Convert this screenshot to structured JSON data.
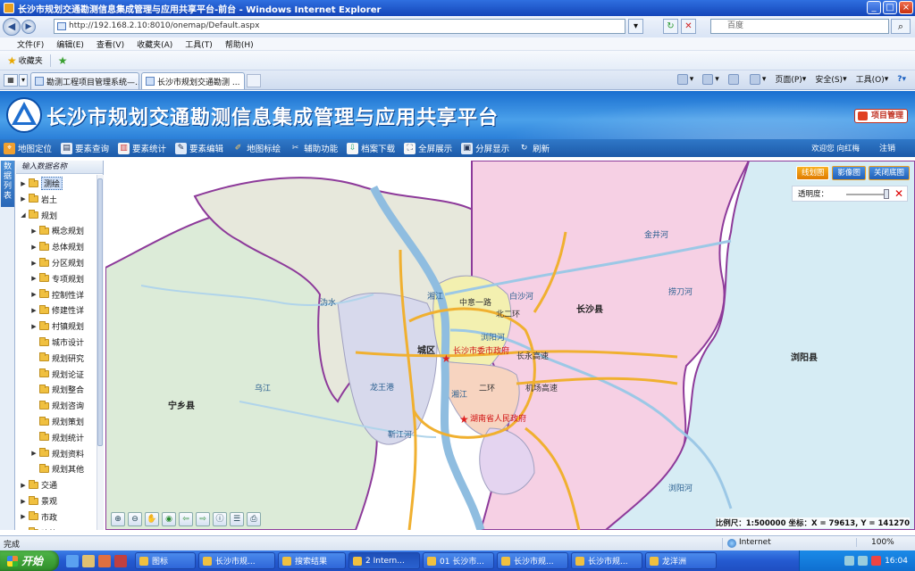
{
  "window": {
    "title": "长沙市规划交通勘测信息集成管理与应用共享平台-前台 - Windows Internet Explorer"
  },
  "browser": {
    "url": "http://192.168.2.10:8010/onemap/Default.aspx",
    "search_placeholder": "百度",
    "menu": [
      "文件(F)",
      "编辑(E)",
      "查看(V)",
      "收藏夹(A)",
      "工具(T)",
      "帮助(H)"
    ],
    "favorites_label": "收藏夹",
    "tabs": [
      {
        "label": "勘测工程项目管理系统—...",
        "active": false
      },
      {
        "label": "长沙市规划交通勘测 ...",
        "active": true
      }
    ],
    "commands": [
      "页面(P)",
      "安全(S)",
      "工具(O)"
    ],
    "status": "完成",
    "zone": "Internet",
    "zoom": "100%"
  },
  "app": {
    "title": "长沙市规划交通勘测信息集成管理与应用共享平台",
    "project_button": "项目管理",
    "toolbar": [
      {
        "label": "地图定位",
        "icon": "map-pin-icon"
      },
      {
        "label": "要素查询",
        "icon": "query-icon"
      },
      {
        "label": "要素统计",
        "icon": "chart-icon"
      },
      {
        "label": "要素编辑",
        "icon": "edit-icon"
      },
      {
        "label": "地图标绘",
        "icon": "draw-icon"
      },
      {
        "label": "辅助功能",
        "icon": "tools-icon"
      },
      {
        "label": "档案下载",
        "icon": "download-icon"
      },
      {
        "label": "全屏展示",
        "icon": "fullscreen-icon"
      },
      {
        "label": "分屏显示",
        "icon": "split-screen-icon"
      },
      {
        "label": "刷新",
        "icon": "refresh-icon"
      }
    ],
    "welcome": "欢迎您  向红梅",
    "logout": "注销",
    "side_tab": "数据列表",
    "side_header": "输入数据名称",
    "tree": [
      {
        "label": "测绘",
        "level": 0,
        "expanded": false,
        "selected": true
      },
      {
        "label": "岩土",
        "level": 0,
        "expanded": false
      },
      {
        "label": "规划",
        "level": 0,
        "expanded": true
      },
      {
        "label": "概念规划",
        "level": 1,
        "expanded": false
      },
      {
        "label": "总体规划",
        "level": 1,
        "expanded": false
      },
      {
        "label": "分区规划",
        "level": 1,
        "expanded": false
      },
      {
        "label": "专项规划",
        "level": 1,
        "expanded": false
      },
      {
        "label": "控制性详",
        "level": 1,
        "expanded": false
      },
      {
        "label": "修建性详",
        "level": 1,
        "expanded": false
      },
      {
        "label": "村镇规划",
        "level": 1,
        "expanded": false
      },
      {
        "label": "城市设计",
        "level": 1,
        "leaf": true
      },
      {
        "label": "规划研究",
        "level": 1,
        "leaf": true
      },
      {
        "label": "规划论证",
        "level": 1,
        "leaf": true
      },
      {
        "label": "规划整合",
        "level": 1,
        "leaf": true
      },
      {
        "label": "规划咨询",
        "level": 1,
        "leaf": true
      },
      {
        "label": "规划策划",
        "level": 1,
        "leaf": true
      },
      {
        "label": "规划统计",
        "level": 1,
        "leaf": true
      },
      {
        "label": "规划资料",
        "level": 1,
        "expanded": false
      },
      {
        "label": "规划其他",
        "level": 1,
        "leaf": true
      },
      {
        "label": "交通",
        "level": 0,
        "expanded": false
      },
      {
        "label": "景观",
        "level": 0,
        "expanded": false
      },
      {
        "label": "市政",
        "level": 0,
        "expanded": false
      },
      {
        "label": "建筑",
        "level": 0,
        "expanded": false
      }
    ],
    "map_buttons": [
      {
        "label": "线划图",
        "active": true
      },
      {
        "label": "影像图",
        "active": false
      },
      {
        "label": "关闭底图",
        "active": false
      }
    ],
    "transparency_label": "透明度：",
    "transparency_value": 0.95,
    "scale_text": "比例尺：1:500000  坐标：X = 79613, Y = 141270",
    "map_labels": {
      "county_ningxiang": "宁乡县",
      "county_changsha": "长沙县",
      "county_liuyang": "浏阳县",
      "city_district": "城区",
      "gov_city": "长沙市委市政府",
      "gov_province": "湖南省人民政府",
      "river_xiang": "湘江",
      "river_xiang2": "湘江",
      "river_wu": "乌江",
      "river_wei": "沩水",
      "river_liuyang": "浏阳河",
      "river_liuyang2": "浏阳河",
      "river_laodao": "捞刀河",
      "river_baisha": "白沙河",
      "river_jin": "金井河",
      "river_jinjiang": "靳江河",
      "river_longwang": "龙王港",
      "ring_north": "北二环",
      "ring_south": "二环",
      "road_airport": "机场高速",
      "road_changyong": "长永高速",
      "road_zhongyi": "中意一路"
    }
  },
  "taskbar": {
    "start": "开始",
    "tasks": [
      "图标",
      "长沙市规...",
      "搜索结果",
      "2 Intern...",
      "01 长沙市...",
      "长沙市规...",
      "长沙市规...",
      "龙洋洲"
    ],
    "clock": "16:04"
  }
}
